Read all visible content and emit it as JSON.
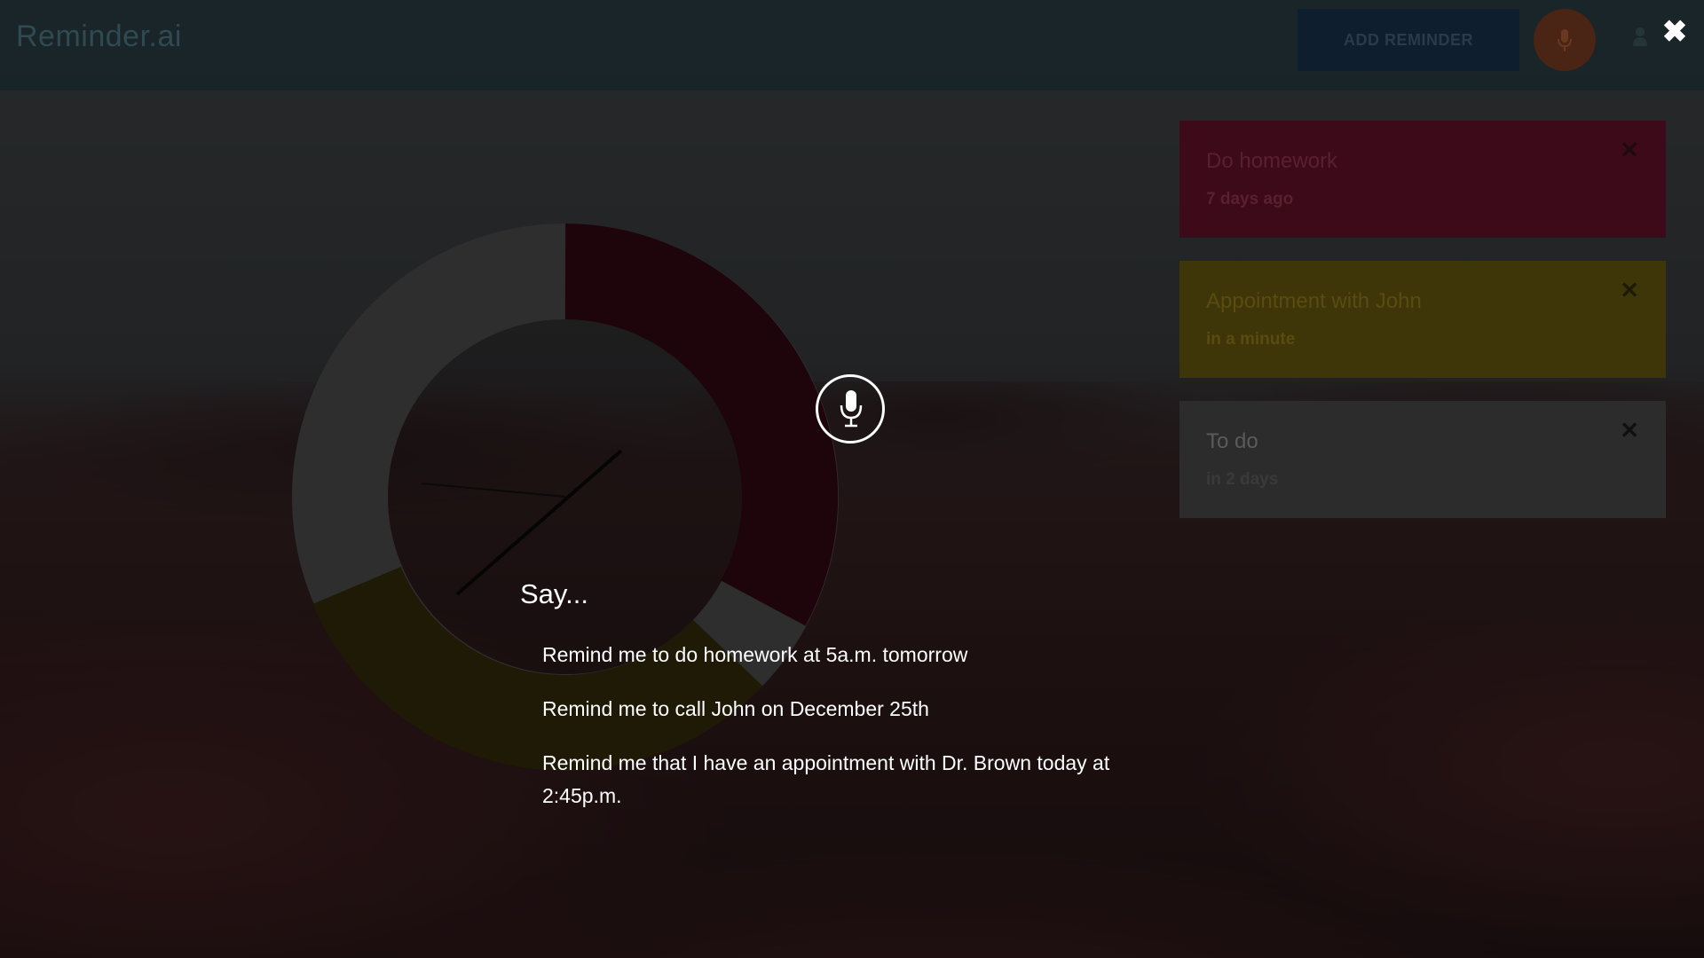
{
  "app": {
    "title": "Reminder.ai"
  },
  "header": {
    "add_reminder_label": "ADD REMINDER",
    "mic_icon": "microphone-icon",
    "user_icon": "user-icon",
    "close_label": "✖"
  },
  "reminders": [
    {
      "title": "Do homework",
      "time": "7 days ago",
      "color": "#3c0a18",
      "close": "✕"
    },
    {
      "title": "Appointment with John",
      "time": "in a minute",
      "color": "#3e3508",
      "close": "✕"
    },
    {
      "title": "To do",
      "time": "in 2 days",
      "color": "#2c2c2c",
      "close": "✕"
    }
  ],
  "voice_prompt": {
    "heading": "Say...",
    "examples": [
      "Remind me to do homework at 5a.m. tomorrow",
      "Remind me to call John on December 25th",
      "Remind me that I have an appointment with Dr. Brown today at 2:45p.m."
    ]
  },
  "colors": {
    "red_segment": "#1e040b",
    "yellow_segment": "#1e1a05",
    "gray_segment": "#2e2e2e"
  }
}
